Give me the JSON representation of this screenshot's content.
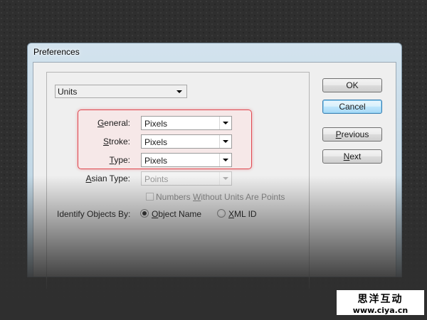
{
  "window": {
    "title": "Preferences"
  },
  "panel": {
    "selected": "Units"
  },
  "units": {
    "general": {
      "label": "General:",
      "value": "Pixels"
    },
    "stroke": {
      "label": "Stroke:",
      "value": "Pixels"
    },
    "type": {
      "label": "Type:",
      "value": "Pixels"
    },
    "asian_type": {
      "label": "Asian Type:",
      "value": "Points"
    },
    "numbers_checkbox": {
      "label": "Numbers Without Units Are Points",
      "checked": false
    },
    "identify": {
      "label": "Identify Objects By:",
      "options": [
        "Object Name",
        "XML ID"
      ],
      "selected": "Object Name"
    }
  },
  "buttons": {
    "ok": "OK",
    "cancel": "Cancel",
    "previous": "Previous",
    "next": "Next"
  },
  "colors": {
    "highlight_border": "#e0474f",
    "primary_button": "#bee6fd",
    "background": "#2f2f2f"
  },
  "watermark": {
    "brand": "思洋互动",
    "url": "www.ciya.cn"
  }
}
